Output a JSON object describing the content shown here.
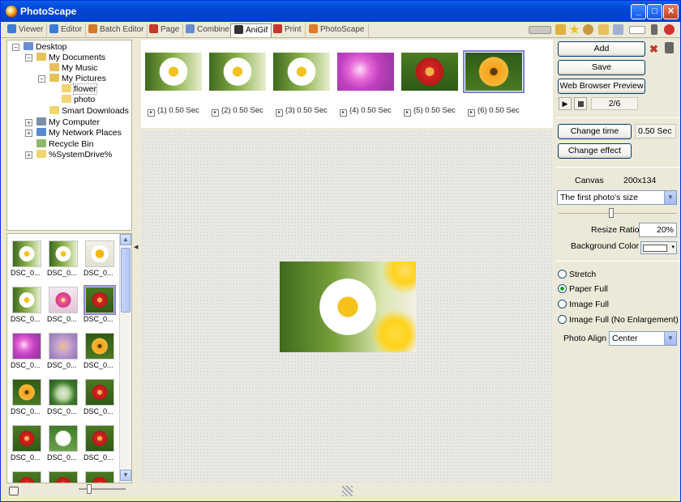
{
  "window": {
    "title": "PhotoScape",
    "min": "_",
    "max": "□",
    "close": "✕"
  },
  "tabs": [
    {
      "label": "Viewer",
      "color": "#3a7bd5"
    },
    {
      "label": "Editor",
      "color": "#3a7bd5"
    },
    {
      "label": "Batch Editor",
      "color": "#d07a2a"
    },
    {
      "label": "Page",
      "color": "#c23a2a"
    },
    {
      "label": "Combine",
      "color": "#6a8ad0"
    },
    {
      "label": "AniGif",
      "color": "#333333"
    },
    {
      "label": "Print",
      "color": "#c0392b"
    },
    {
      "label": "PhotoScape",
      "color": "#e07a2a"
    }
  ],
  "toolbar_icons": [
    "menu-icon",
    "folder-icon",
    "star-icon",
    "settings-icon",
    "open-folder-icon",
    "window-icon",
    "blank-icon",
    "tools-icon",
    "help-icon"
  ],
  "tree": [
    {
      "label": "Desktop",
      "toggle": "−",
      "icon": "desktop-icon",
      "color": "#6c8fd2"
    },
    {
      "label": "My Documents",
      "toggle": "−",
      "icon": "documents-folder-icon",
      "color": "#e7c15a"
    },
    {
      "label": "My Music",
      "toggle": "",
      "icon": "music-folder-icon",
      "color": "#e7c15a"
    },
    {
      "label": "My Pictures",
      "toggle": "−",
      "icon": "pictures-folder-icon",
      "color": "#e7c15a"
    },
    {
      "label": "flower",
      "toggle": "",
      "icon": "folder-icon",
      "color": "#f1d570"
    },
    {
      "label": "photo",
      "toggle": "",
      "icon": "folder-icon",
      "color": "#f1d570"
    },
    {
      "label": "Smart Downloads",
      "toggle": "",
      "icon": "folder-icon",
      "color": "#f1d570"
    },
    {
      "label": "My Computer",
      "toggle": "+",
      "icon": "computer-icon",
      "color": "#7a8ea8"
    },
    {
      "label": "My Network Places",
      "toggle": "+",
      "icon": "network-icon",
      "color": "#5a8ad0"
    },
    {
      "label": "Recycle Bin",
      "toggle": "",
      "icon": "recycle-bin-icon",
      "color": "#8fb86a"
    },
    {
      "label": "%SystemDrive%",
      "toggle": "+",
      "icon": "folder-icon",
      "color": "#f1d570"
    }
  ],
  "thumbnails": [
    {
      "caption": "DSC_0...",
      "palette": "daisy"
    },
    {
      "caption": "DSC_0...",
      "palette": "daisy"
    },
    {
      "caption": "DSC_0...",
      "palette": "yellowwhite"
    },
    {
      "caption": "DSC_0...",
      "palette": "daisy"
    },
    {
      "caption": "DSC_0...",
      "palette": "pink"
    },
    {
      "caption": "DSC_0...",
      "palette": "red"
    },
    {
      "caption": "DSC_0...",
      "palette": "magenta"
    },
    {
      "caption": "DSC_0...",
      "palette": "lilac"
    },
    {
      "caption": "DSC_0...",
      "palette": "orange"
    },
    {
      "caption": "DSC_0...",
      "palette": "orange"
    },
    {
      "caption": "DSC_0...",
      "palette": "green"
    },
    {
      "caption": "DSC_0...",
      "palette": "red"
    },
    {
      "caption": "DSC_0...",
      "palette": "red"
    },
    {
      "caption": "DSC_0...",
      "palette": "whitegreen"
    },
    {
      "caption": "DSC_0...",
      "palette": "red"
    },
    {
      "caption": "DSC_0...",
      "palette": "red"
    },
    {
      "caption": "DSC_0...",
      "palette": "red"
    },
    {
      "caption": "DSC_0...",
      "palette": "red"
    }
  ],
  "frames": [
    {
      "label": "(1) 0.50 Sec",
      "palette": "daisy"
    },
    {
      "label": "(2) 0.50 Sec",
      "palette": "daisy"
    },
    {
      "label": "(3) 0.50 Sec",
      "palette": "daisy"
    },
    {
      "label": "(4) 0.50 Sec",
      "palette": "magenta"
    },
    {
      "label": "(5) 0.50 Sec",
      "palette": "red"
    },
    {
      "label": "(6) 0.50 Sec",
      "palette": "orange"
    }
  ],
  "right": {
    "add": "Add",
    "save": "Save",
    "web_preview": "Web Browser Preview",
    "page_counter": "2/6",
    "change_time": "Change time",
    "time_value": "0.50 Sec",
    "change_effect": "Change effect",
    "canvas_label": "Canvas",
    "canvas_size": "200x134",
    "size_mode": "The first photo's size",
    "resize_ratio_label": "Resize Ratio",
    "resize_ratio": "20%",
    "bg_color_label": "Background Color",
    "fit_options": [
      {
        "label": "Stretch",
        "checked": false
      },
      {
        "label": "Paper Full",
        "checked": true
      },
      {
        "label": "Image Full",
        "checked": false
      },
      {
        "label": "Image Full (No Enlargement)",
        "checked": false
      }
    ],
    "photo_align_label": "Photo Align",
    "photo_align": "Center"
  },
  "colors": {
    "xp_blue": "#0046d5",
    "selection": "#7b7fe0",
    "tab_active": "#ffffff"
  }
}
